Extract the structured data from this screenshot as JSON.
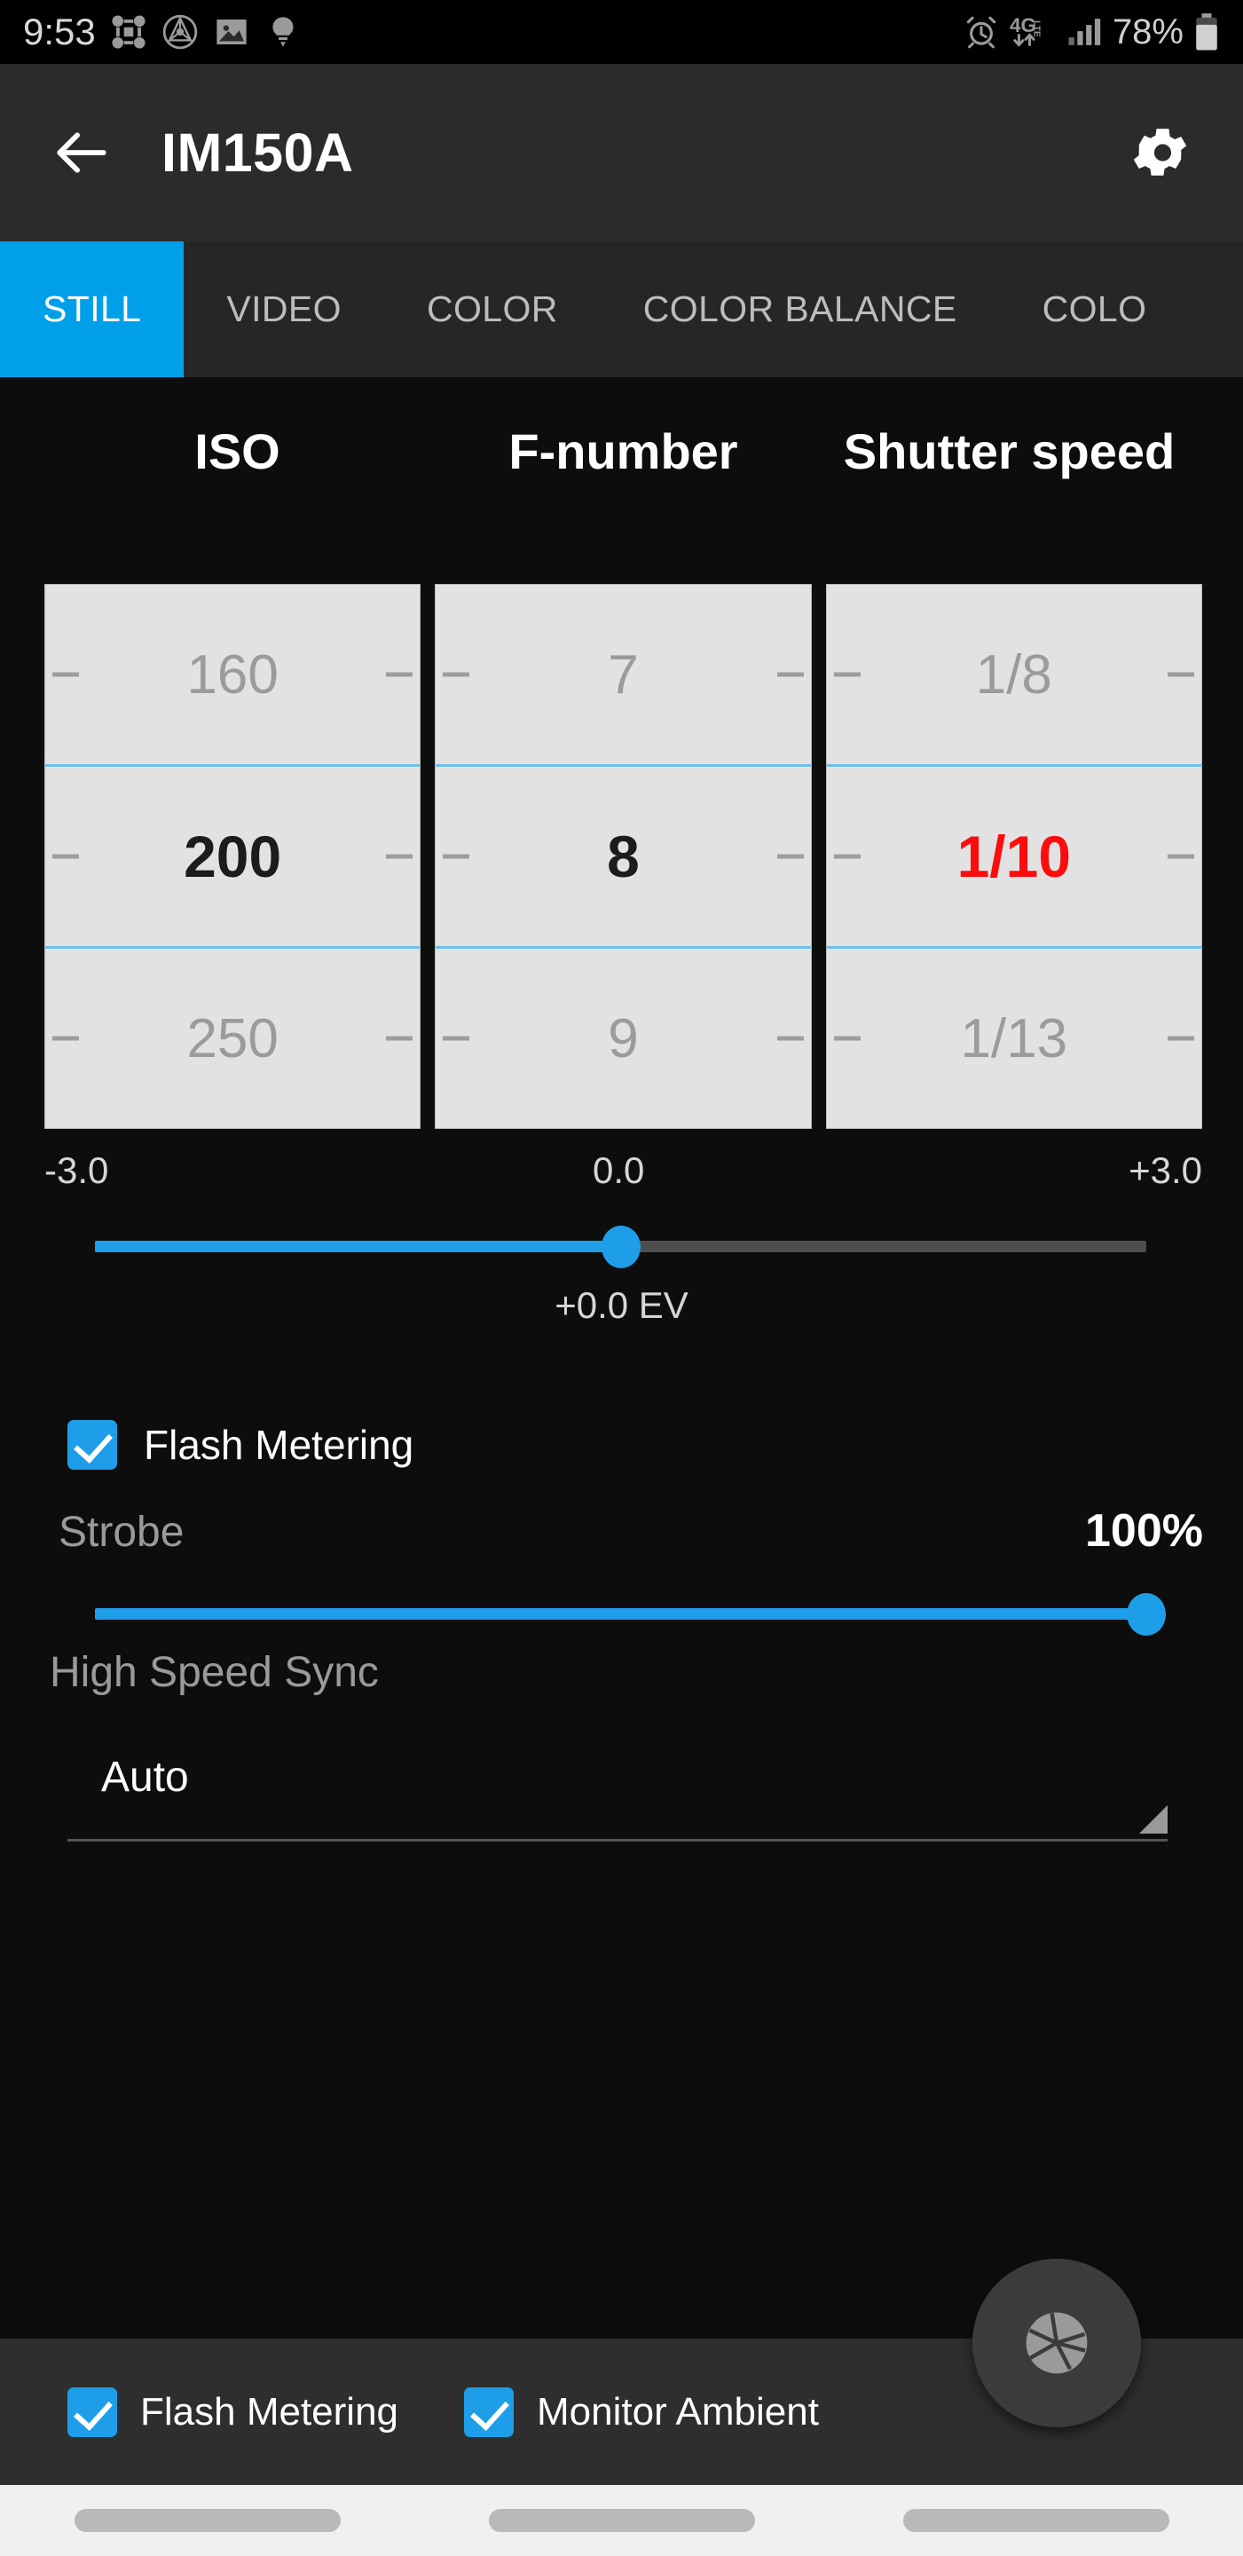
{
  "status_bar": {
    "time": "9:53",
    "battery_percent": "78%",
    "left_icons": [
      "node-cluster-icon",
      "compass-circle-icon",
      "image-icon",
      "lightbulb-icon"
    ],
    "right_icons": [
      "alarm-icon",
      "4g-lte-icon",
      "signal-bars-icon",
      "battery-icon"
    ],
    "network_label": "4G",
    "network_sub": "LTE"
  },
  "app_bar": {
    "title": "IM150A",
    "back_icon": "arrow-left-icon",
    "settings_icon": "gear-icon"
  },
  "tabs": [
    {
      "label": "STILL",
      "active": true
    },
    {
      "label": "VIDEO",
      "active": false
    },
    {
      "label": "COLOR",
      "active": false
    },
    {
      "label": "COLOR BALANCE",
      "active": false
    },
    {
      "label": "COLO",
      "active": false
    }
  ],
  "pickers": [
    {
      "title": "ISO",
      "above": "160",
      "selected": "200",
      "below": "250",
      "selected_color": "#1c1c1c"
    },
    {
      "title": "F-number",
      "above": "7",
      "selected": "8",
      "below": "9",
      "selected_color": "#1c1c1c"
    },
    {
      "title": "Shutter speed",
      "above": "1/8",
      "selected": "1/10",
      "below": "1/13",
      "selected_color": "#fc0d0d"
    }
  ],
  "ev_slider": {
    "min_label": "-3.0",
    "mid_label": "0.0",
    "max_label": "+3.0",
    "value_label": "+0.0 EV",
    "value_percent": 50
  },
  "flash_metering": {
    "label": "Flash Metering",
    "checked": true
  },
  "strobe": {
    "label": "Strobe",
    "value_label": "100%",
    "value_percent": 100
  },
  "high_speed_sync": {
    "label": "High Speed Sync",
    "value": "Auto",
    "arrow_icon": "dropdown-triangle-icon"
  },
  "fab": {
    "icon": "aperture-shutter-icon"
  },
  "bottom_bar": {
    "items": [
      {
        "label": "Flash Metering",
        "checked": true
      },
      {
        "label": "Monitor Ambient",
        "checked": true
      }
    ]
  },
  "colors": {
    "accent_blue": "#00a0e9",
    "slider_blue": "#1e9ee8",
    "selected_red": "#fc0d0d",
    "picker_bg": "#e2e2e2",
    "app_bar_bg": "#2b2b2b",
    "page_bg": "#0d0d0d"
  }
}
